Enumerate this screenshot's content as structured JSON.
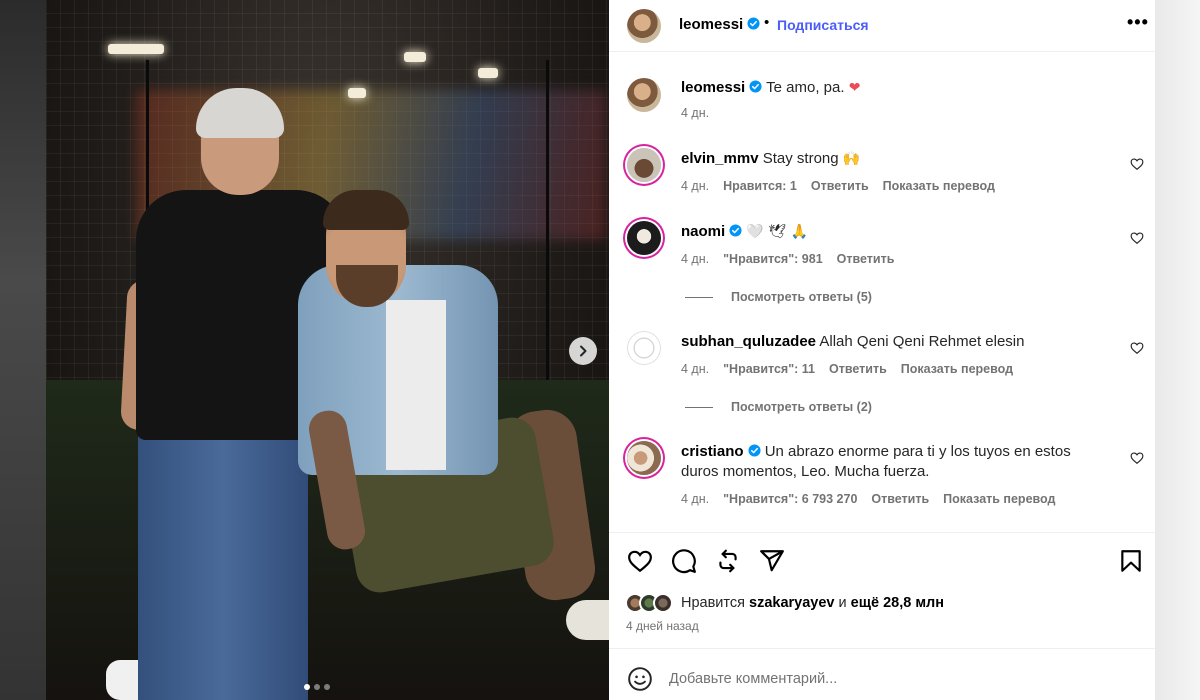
{
  "post": {
    "author": "leomessi",
    "follow_label": "Подписаться",
    "separator": "•",
    "more_label": "•••",
    "caption_text": "Te amo, pa.",
    "caption_emoji": "❤",
    "caption_time": "4 дн."
  },
  "comments": [
    {
      "user": "elvin_mmv",
      "text": "Stay strong",
      "emoji": "🙌",
      "time": "4 дн.",
      "likes": "Нравится: 1",
      "reply": "Ответить",
      "translate": "Показать перевод"
    },
    {
      "user": "naomi",
      "text": "",
      "emoji": "🤍 🕊 🙏",
      "time": "4 дн.",
      "likes": "\"Нравится\": 981",
      "reply": "Ответить",
      "view_replies": "Посмотреть ответы (5)"
    },
    {
      "user": "subhan_quluzadee",
      "text": "Allah Qeni Qeni Rehmet elesin",
      "time": "4 дн.",
      "likes": "\"Нравится\": 11",
      "reply": "Ответить",
      "translate": "Показать перевод",
      "view_replies": "Посмотреть ответы (2)"
    },
    {
      "user": "cristiano",
      "text": "Un abrazo enorme para ti y los tuyos en estos duros momentos, Leo. Mucha fuerza.",
      "time": "4 дн.",
      "likes": "\"Нравится\": 6 793 270",
      "reply": "Ответить",
      "translate": "Показать перевод"
    }
  ],
  "likes_summary": {
    "prefix": "Нравится",
    "user": "szakaryayev",
    "middle": "и",
    "rest": "ещё 28,8 млн"
  },
  "post_date": "4 дней назад",
  "comment_box": {
    "placeholder": "Добавьте комментарий..."
  },
  "icons": {
    "verified": "verified-badge-icon",
    "heart": "heart-icon",
    "comment": "comment-icon",
    "repost": "repost-icon",
    "share": "share-icon",
    "save": "bookmark-icon",
    "emoji": "emoji-icon",
    "next": "chevron-right-icon"
  },
  "colors": {
    "accent": "#4a5df9",
    "verified": "#0095f6",
    "muted": "#737373",
    "heart": "#ed4956"
  },
  "carousel": {
    "slide_count": 3,
    "active_index": 0
  }
}
